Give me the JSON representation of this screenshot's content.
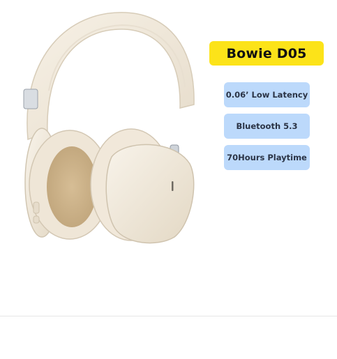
{
  "product": {
    "name": "Bowie D05",
    "image_icon": "headphones-icon",
    "features": [
      "0.06’ Low Latency",
      "Bluetooth 5.3",
      "70Hours Playtime"
    ]
  },
  "colors": {
    "title_badge": "#fce319",
    "feature_badge": "#bcd9fb",
    "headphone_body": "#f3ebdd",
    "cushion_fabric": "#dcc7a5"
  }
}
